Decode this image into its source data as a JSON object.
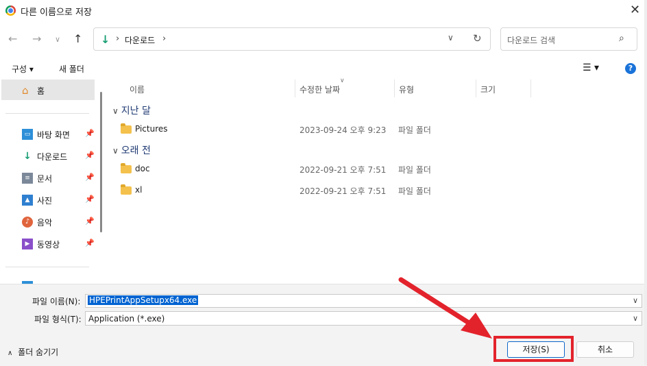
{
  "window": {
    "title": "다른 이름으로 저장",
    "close_icon": "close-icon"
  },
  "nav": {
    "breadcrumb": "다운로드",
    "search_placeholder": "다운로드 검색"
  },
  "toolbar": {
    "organize": "구성 ▾",
    "new_folder": "새 폴더",
    "help": "?"
  },
  "sidebar": {
    "home": "홈",
    "items": [
      {
        "label": "바탕 화면",
        "icon": "desktop-icon"
      },
      {
        "label": "다운로드",
        "icon": "download-icon"
      },
      {
        "label": "문서",
        "icon": "document-icon"
      },
      {
        "label": "사진",
        "icon": "pictures-icon"
      },
      {
        "label": "음악",
        "icon": "music-icon"
      },
      {
        "label": "동영상",
        "icon": "video-icon"
      }
    ]
  },
  "list": {
    "columns": [
      "이름",
      "수정한 날짜",
      "유형",
      "크기"
    ],
    "groups": [
      {
        "label": "지난 달",
        "rows": [
          {
            "name": "Pictures",
            "date": "2023-09-24 오후 9:23",
            "type": "파일 폴더"
          }
        ]
      },
      {
        "label": "오래 전",
        "rows": [
          {
            "name": "doc",
            "date": "2022-09-21 오후 7:51",
            "type": "파일 폴더"
          },
          {
            "name": "xl",
            "date": "2022-09-21 오후 7:51",
            "type": "파일 폴더"
          }
        ]
      }
    ]
  },
  "form": {
    "filename_label": "파일 이름(N):",
    "filename_value": "HPEPrintAppSetupx64.exe",
    "filetype_label": "파일 형식(T):",
    "filetype_value": "Application (*.exe)"
  },
  "footer": {
    "hide_folders": "폴더 숨기기",
    "save": "저장(S)",
    "cancel": "취소"
  },
  "colors": {
    "accent": "#0063d1",
    "highlight": "#e3232c"
  }
}
